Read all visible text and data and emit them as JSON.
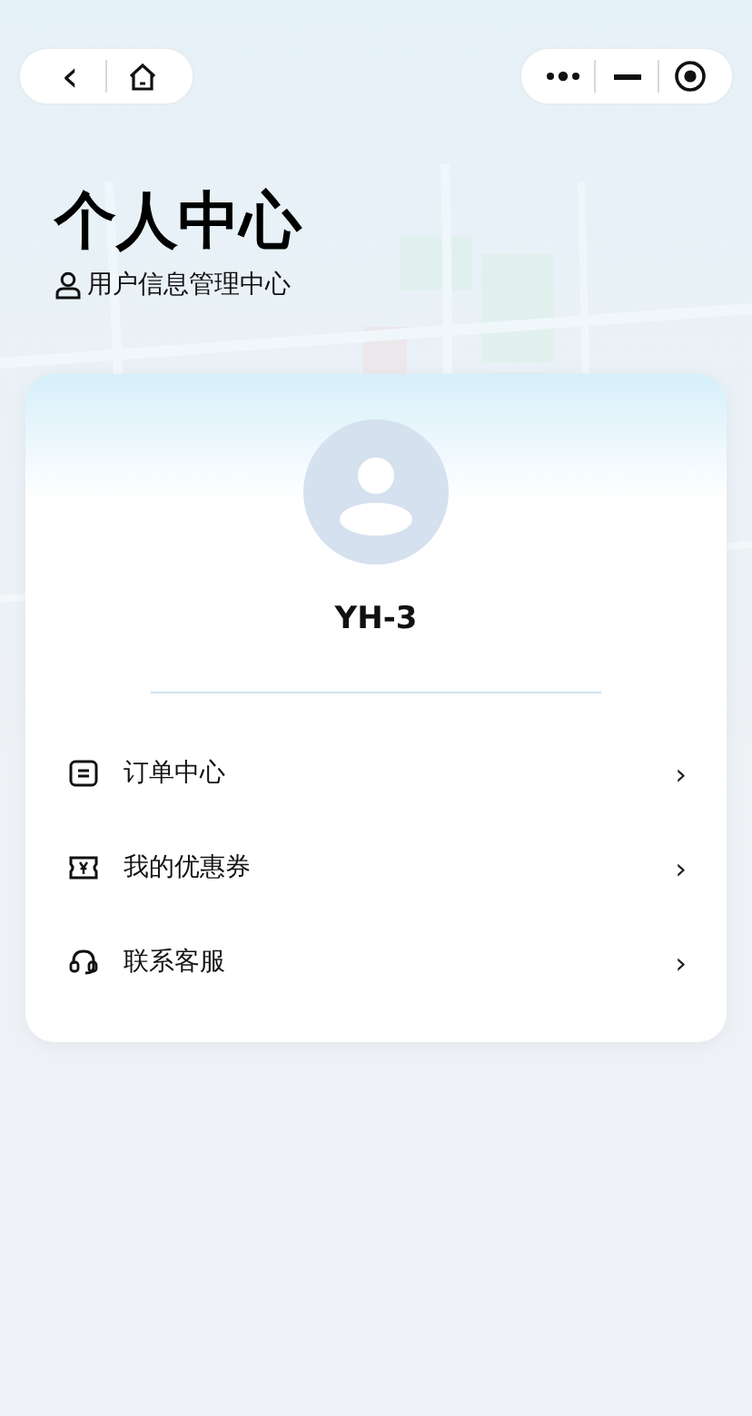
{
  "nav_capsule": {
    "back": "‹"
  },
  "header": {
    "title": "个人中心",
    "subtitle": "用户信息管理中心"
  },
  "profile": {
    "username": "YH-3"
  },
  "menu": [
    {
      "kind": "order",
      "label": "订单中心",
      "arrow": "›"
    },
    {
      "kind": "coupon",
      "label": "我的优惠券",
      "arrow": "›"
    },
    {
      "kind": "service",
      "label": "联系客服",
      "arrow": "›"
    }
  ]
}
